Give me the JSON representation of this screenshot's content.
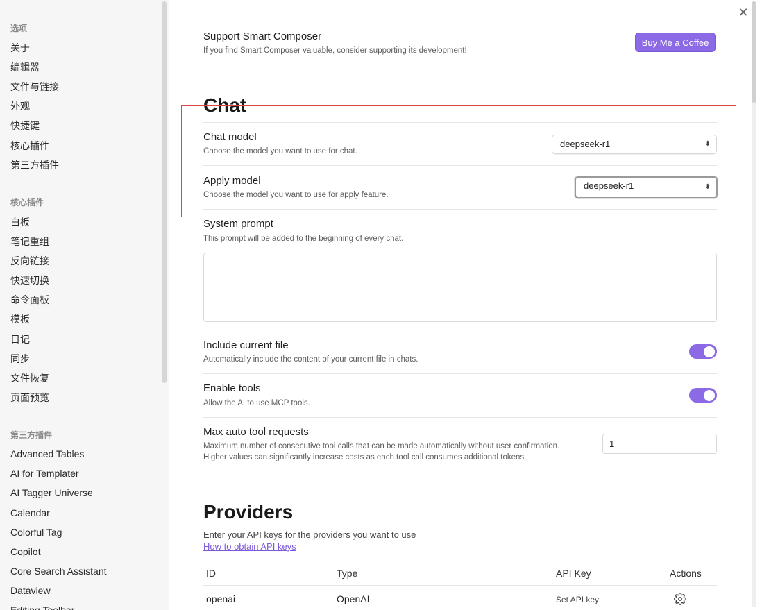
{
  "sidebar": {
    "sections": [
      {
        "heading": "选项",
        "items": [
          "关于",
          "编辑器",
          "文件与链接",
          "外观",
          "快捷键",
          "核心插件",
          "第三方插件"
        ]
      },
      {
        "heading": "核心插件",
        "items": [
          "白板",
          "笔记重组",
          "反向链接",
          "快速切换",
          "命令面板",
          "模板",
          "日记",
          "同步",
          "文件恢复",
          "页面预览"
        ]
      },
      {
        "heading": "第三方插件",
        "items": [
          "Advanced Tables",
          "AI for Templater",
          "AI Tagger Universe",
          "Calendar",
          "Colorful Tag",
          "Copilot",
          "Core Search Assistant",
          "Dataview",
          "Editing Toolbar"
        ]
      }
    ]
  },
  "main": {
    "close_icon": "close-icon",
    "support": {
      "title": "Support Smart Composer",
      "desc": "If you find Smart Composer valuable, consider supporting its development!",
      "button": "Buy Me a Coffee"
    },
    "chat": {
      "heading": "Chat",
      "chat_model": {
        "title": "Chat model",
        "desc": "Choose the model you want to use for chat.",
        "value": "deepseek-r1"
      },
      "apply_model": {
        "title": "Apply model",
        "desc": "Choose the model you want to use for apply feature.",
        "value": "deepseek-r1"
      },
      "system_prompt": {
        "title": "System prompt",
        "desc": "This prompt will be added to the beginning of every chat.",
        "value": ""
      },
      "include_file": {
        "title": "Include current file",
        "desc": "Automatically include the content of your current file in chats.",
        "enabled": true
      },
      "enable_tools": {
        "title": "Enable tools",
        "desc": "Allow the AI to use MCP tools.",
        "enabled": true
      },
      "max_tool": {
        "title": "Max auto tool requests",
        "desc1": "Maximum number of consecutive tool calls that can be made automatically without user confirmation.",
        "desc2": "Higher values can significantly increase costs as each tool call consumes additional tokens.",
        "value": "1"
      }
    },
    "providers": {
      "heading": "Providers",
      "desc": "Enter your API keys for the providers you want to use",
      "link": "How to obtain API keys",
      "columns": [
        "ID",
        "Type",
        "API Key",
        "Actions"
      ],
      "rows": [
        {
          "id": "openai",
          "type": "OpenAI",
          "api_key": "Set API key",
          "action_icon": "gear-icon"
        }
      ]
    }
  },
  "colors": {
    "accent": "#8c6ae6",
    "highlight": "#d44444"
  }
}
